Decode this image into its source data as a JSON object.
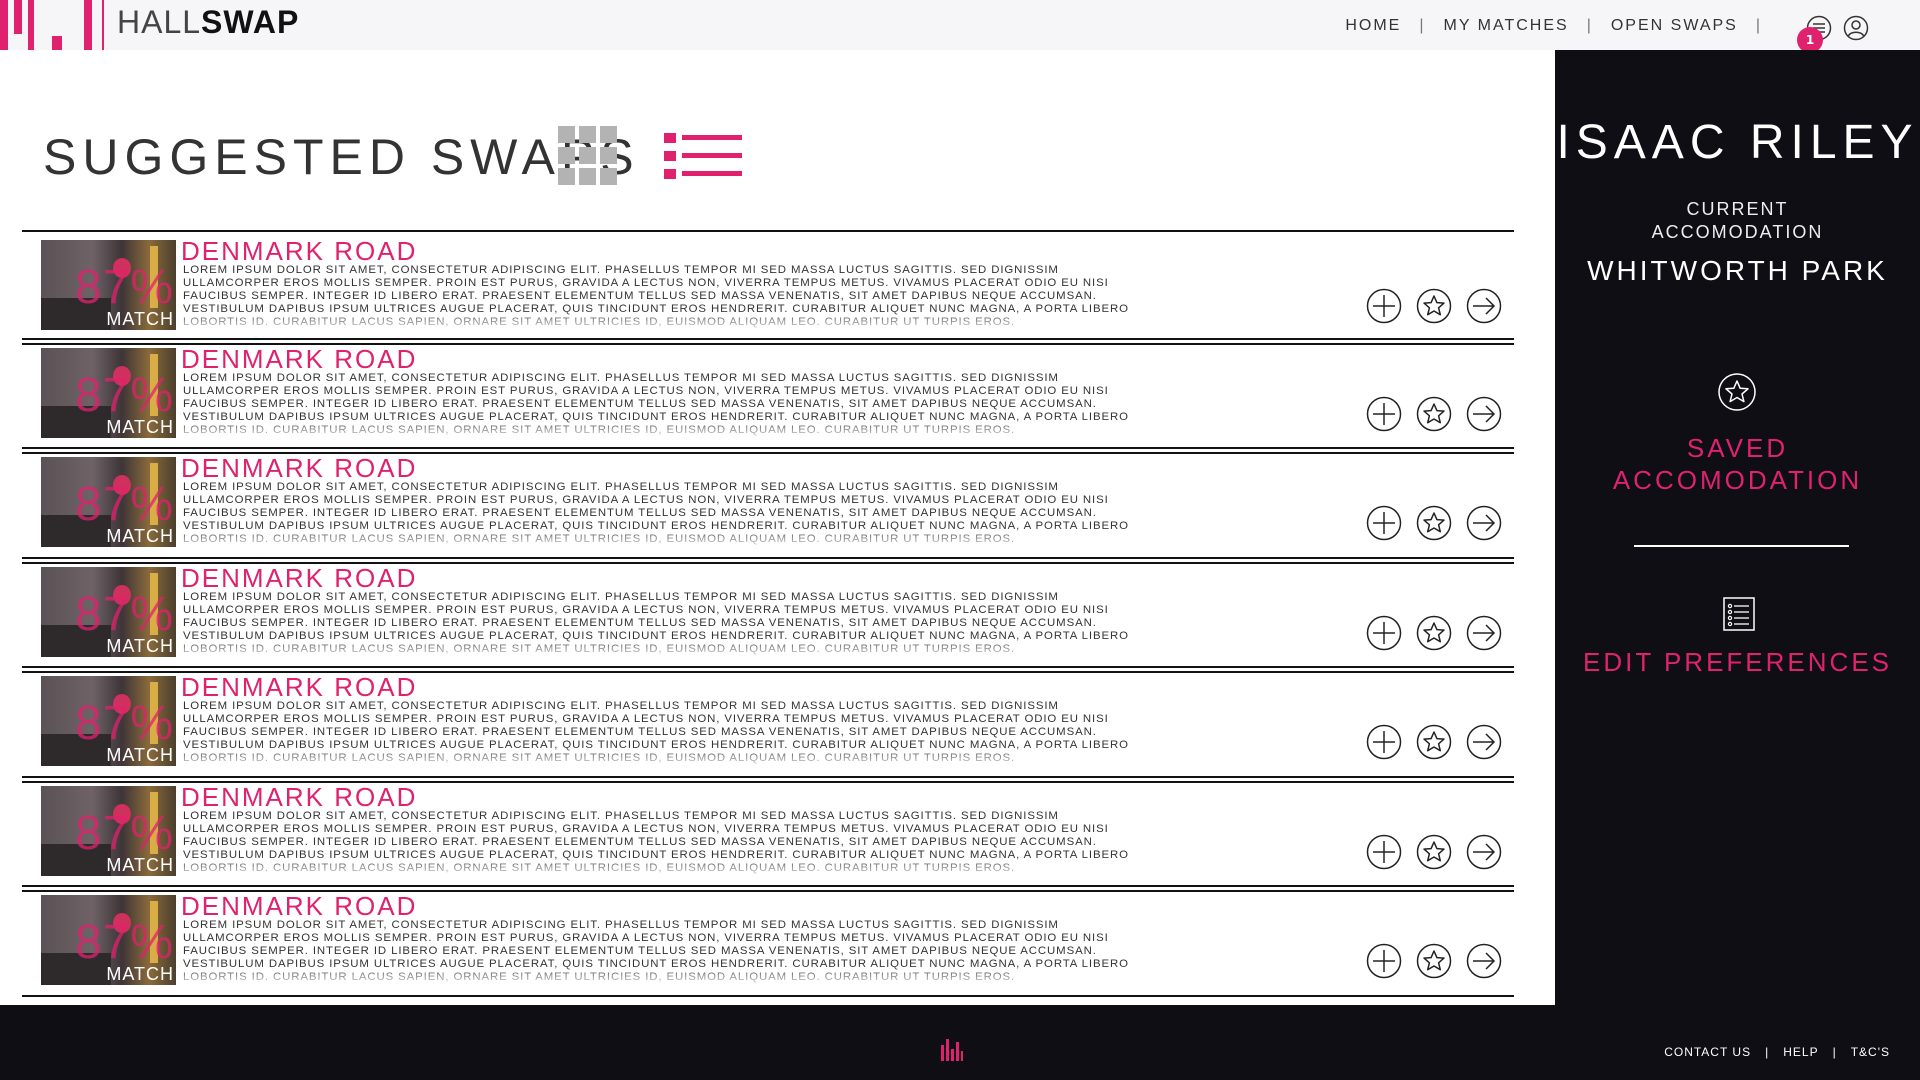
{
  "brand": {
    "name_thin": "HALL",
    "name_bold": "SWAP"
  },
  "nav": {
    "items": [
      {
        "label": "HOME"
      },
      {
        "label": "MY MATCHES"
      },
      {
        "label": "OPEN SWAPS"
      }
    ],
    "separator": "|",
    "notification_count": "1",
    "icons": [
      "menu-icon",
      "user-icon"
    ]
  },
  "main": {
    "title": "SUGGESTED SWAPS",
    "views": [
      "grid-view-icon",
      "list-view-icon"
    ],
    "active_view": "list"
  },
  "listings": [
    {
      "title": "DENMARK ROAD",
      "match_percent": "87%",
      "match_label": "MATCH",
      "description": "Lorem ipsum dolor sit amet, consectetur adipiscing elit. Phasellus tempor mi sed massa luctus sagittis. Sed dignissim ullamcorper eros mollis semper. Proin est purus, gravida a lectus non, viverra tempus metus. Vivamus placerat odio eu nisi faucibus semper. Integer id libero erat. Praesent elementum tellus sed massa venenatis, sit amet dapibus neque accumsan. Vestibulum dapibus ipsum ultrices augue placerat, quis tincidunt eros hendrerit. Curabitur aliquet nunc magna, a porta libero lobortis id. Curabitur lacus sapien, ornare sit amet ultricies id, euismod aliquam leo. Curabitur ut turpis eros."
    },
    {
      "title": "DENMARK ROAD",
      "match_percent": "87%",
      "match_label": "MATCH",
      "description": "Lorem ipsum dolor sit amet, consectetur adipiscing elit. Phasellus tempor mi sed massa luctus sagittis. Sed dignissim ullamcorper eros mollis semper. Proin est purus, gravida a lectus non, viverra tempus metus. Vivamus placerat odio eu nisi faucibus semper. Integer id libero erat. Praesent elementum tellus sed massa venenatis, sit amet dapibus neque accumsan. Vestibulum dapibus ipsum ultrices augue placerat, quis tincidunt eros hendrerit. Curabitur aliquet nunc magna, a porta libero lobortis id. Curabitur lacus sapien, ornare sit amet ultricies id, euismod aliquam leo. Curabitur ut turpis eros."
    },
    {
      "title": "DENMARK ROAD",
      "match_percent": "87%",
      "match_label": "MATCH",
      "description": "Lorem ipsum dolor sit amet, consectetur adipiscing elit. Phasellus tempor mi sed massa luctus sagittis. Sed dignissim ullamcorper eros mollis semper. Proin est purus, gravida a lectus non, viverra tempus metus. Vivamus placerat odio eu nisi faucibus semper. Integer id libero erat. Praesent elementum tellus sed massa venenatis, sit amet dapibus neque accumsan. Vestibulum dapibus ipsum ultrices augue placerat, quis tincidunt eros hendrerit. Curabitur aliquet nunc magna, a porta libero lobortis id. Curabitur lacus sapien, ornare sit amet ultricies id, euismod aliquam leo. Curabitur ut turpis eros."
    },
    {
      "title": "DENMARK ROAD",
      "match_percent": "87%",
      "match_label": "MATCH",
      "description": "Lorem ipsum dolor sit amet, consectetur adipiscing elit. Phasellus tempor mi sed massa luctus sagittis. Sed dignissim ullamcorper eros mollis semper. Proin est purus, gravida a lectus non, viverra tempus metus. Vivamus placerat odio eu nisi faucibus semper. Integer id libero erat. Praesent elementum tellus sed massa venenatis, sit amet dapibus neque accumsan. Vestibulum dapibus ipsum ultrices augue placerat, quis tincidunt eros hendrerit. Curabitur aliquet nunc magna, a porta libero lobortis id. Curabitur lacus sapien, ornare sit amet ultricies id, euismod aliquam leo. Curabitur ut turpis eros."
    },
    {
      "title": "DENMARK ROAD",
      "match_percent": "87%",
      "match_label": "MATCH",
      "description": "Lorem ipsum dolor sit amet, consectetur adipiscing elit. Phasellus tempor mi sed massa luctus sagittis. Sed dignissim ullamcorper eros mollis semper. Proin est purus, gravida a lectus non, viverra tempus metus. Vivamus placerat odio eu nisi faucibus semper. Integer id libero erat. Praesent elementum tellus sed massa venenatis, sit amet dapibus neque accumsan. Vestibulum dapibus ipsum ultrices augue placerat, quis tincidunt eros hendrerit. Curabitur aliquet nunc magna, a porta libero lobortis id. Curabitur lacus sapien, ornare sit amet ultricies id, euismod aliquam leo. Curabitur ut turpis eros."
    },
    {
      "title": "DENMARK ROAD",
      "match_percent": "87%",
      "match_label": "MATCH",
      "description": "Lorem ipsum dolor sit amet, consectetur adipiscing elit. Phasellus tempor mi sed massa luctus sagittis. Sed dignissim ullamcorper eros mollis semper. Proin est purus, gravida a lectus non, viverra tempus metus. Vivamus placerat odio eu nisi faucibus semper. Integer id libero erat. Praesent elementum tellus sed massa venenatis, sit amet dapibus neque accumsan. Vestibulum dapibus ipsum ultrices augue placerat, quis tincidunt eros hendrerit. Curabitur aliquet nunc magna, a porta libero lobortis id. Curabitur lacus sapien, ornare sit amet ultricies id, euismod aliquam leo. Curabitur ut turpis eros."
    },
    {
      "title": "DENMARK ROAD",
      "match_percent": "87%",
      "match_label": "MATCH",
      "description": "Lorem ipsum dolor sit amet, consectetur adipiscing elit. Phasellus tempor mi sed massa luctus sagittis. Sed dignissim ullamcorper eros mollis semper. Proin est purus, gravida a lectus non, viverra tempus metus. Vivamus placerat odio eu nisi faucibus semper. Integer id libero erat. Praesent elementum tellus sed massa venenatis, sit amet dapibus neque accumsan. Vestibulum dapibus ipsum ultrices augue placerat, quis tincidunt eros hendrerit. Curabitur aliquet nunc magna, a porta libero lobortis id. Curabitur lacus sapien, ornare sit amet ultricies id, euismod aliquam leo. Curabitur ut turpis eros."
    }
  ],
  "listing_actions": [
    "add-icon",
    "star-icon",
    "arrow-right-icon"
  ],
  "sidebar": {
    "user_name": "ISAAC RILEY",
    "current_label_line1": "CURRENT",
    "current_label_line2": "ACCOMODATION",
    "current_value": "WHITWORTH PARK",
    "saved_label_line1": "SAVED",
    "saved_label_line2": "ACCOMODATION",
    "preferences_label": "EDIT PREFERENCES"
  },
  "footer": {
    "links": [
      {
        "label": "CONTACT US"
      },
      {
        "label": "HELP"
      },
      {
        "label": "T&C'S"
      }
    ],
    "separator": "|"
  },
  "colors": {
    "accent": "#e0226e",
    "dark": "#0e0e14",
    "header_bg": "#f6f6f8"
  }
}
